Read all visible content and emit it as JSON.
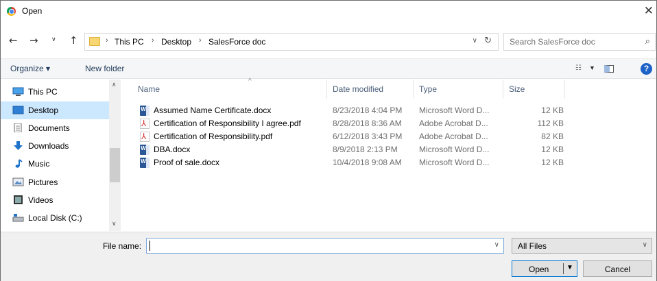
{
  "window": {
    "title": "Open"
  },
  "address": {
    "crumbs": [
      "This PC",
      "Desktop",
      "SalesForce doc"
    ],
    "search_placeholder": "Search SalesForce doc"
  },
  "toolbar": {
    "organize": "Organize ▾",
    "new_folder": "New folder"
  },
  "nav": {
    "items": [
      {
        "label": "This PC",
        "icon": "pc-icon"
      },
      {
        "label": "Desktop",
        "icon": "desktop-icon",
        "selected": true
      },
      {
        "label": "Documents",
        "icon": "documents-icon"
      },
      {
        "label": "Downloads",
        "icon": "downloads-icon"
      },
      {
        "label": "Music",
        "icon": "music-icon"
      },
      {
        "label": "Pictures",
        "icon": "pictures-icon"
      },
      {
        "label": "Videos",
        "icon": "videos-icon"
      },
      {
        "label": "Local Disk (C:)",
        "icon": "disk-icon"
      }
    ]
  },
  "columns": {
    "name": "Name",
    "date": "Date modified",
    "type": "Type",
    "size": "Size"
  },
  "files": [
    {
      "name": "Assumed Name Certificate.docx",
      "date": "8/23/2018 4:04 PM",
      "type": "Microsoft Word D...",
      "size": "12 KB",
      "icon": "word-icon"
    },
    {
      "name": "Certification of Responsibility I agree.pdf",
      "date": "8/28/2018 8:36 AM",
      "type": "Adobe Acrobat D...",
      "size": "112 KB",
      "icon": "pdf-icon"
    },
    {
      "name": "Certification of Responsibility.pdf",
      "date": "6/12/2018 3:43 PM",
      "type": "Adobe Acrobat D...",
      "size": "82 KB",
      "icon": "pdf-icon"
    },
    {
      "name": "DBA.docx",
      "date": "8/9/2018 2:13 PM",
      "type": "Microsoft Word D...",
      "size": "12 KB",
      "icon": "word-icon"
    },
    {
      "name": "Proof of sale.docx",
      "date": "10/4/2018 9:08 AM",
      "type": "Microsoft Word D...",
      "size": "12 KB",
      "icon": "word-icon"
    }
  ],
  "footer": {
    "file_name_label": "File name:",
    "file_name_value": "",
    "filter": "All Files",
    "open": "Open",
    "cancel": "Cancel"
  },
  "colors": {
    "selection": "#cce8ff",
    "accent": "#0078d7"
  }
}
